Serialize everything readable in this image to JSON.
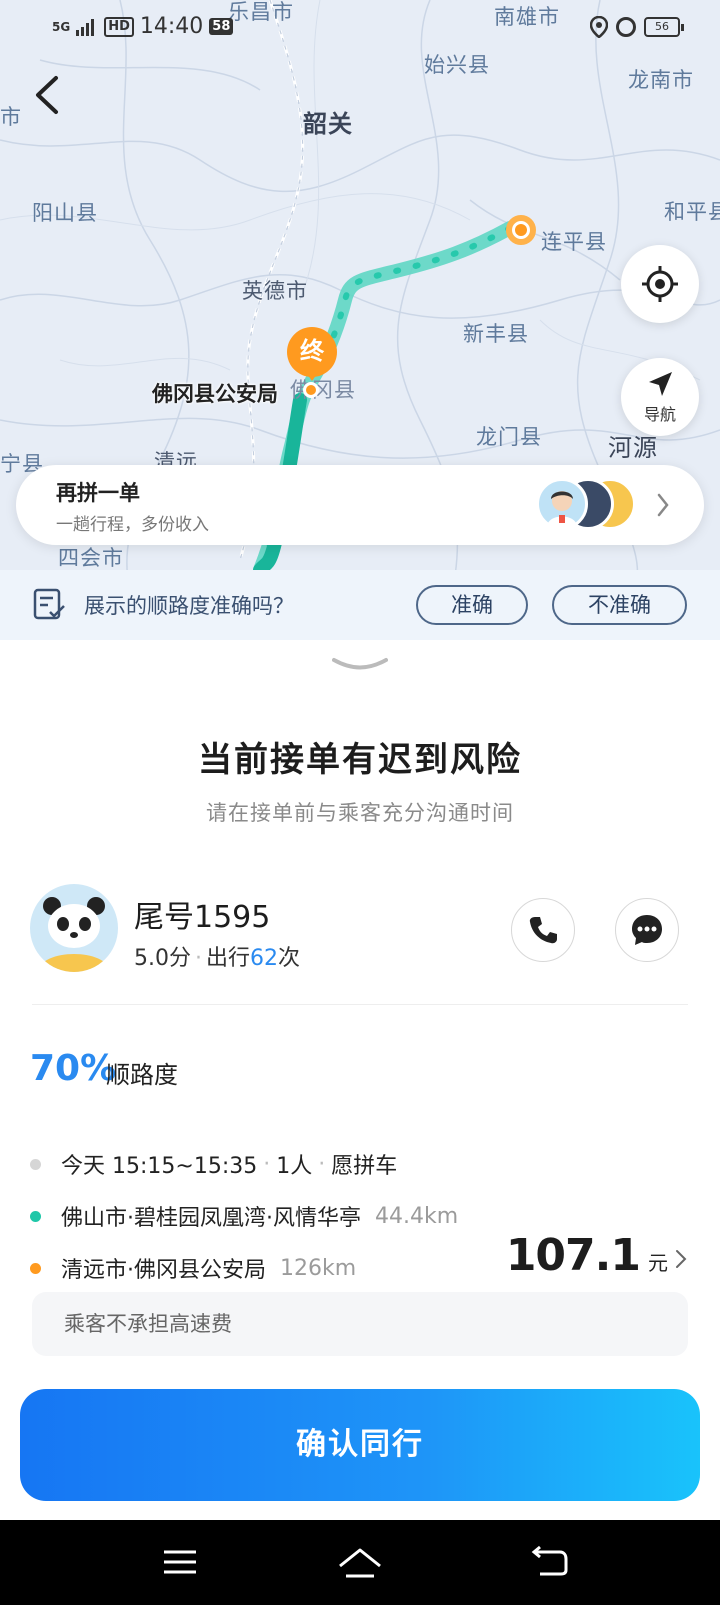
{
  "status_bar": {
    "network": "5G",
    "hd": "HD",
    "time": "14:40",
    "badge": "58",
    "battery": "56"
  },
  "map": {
    "places": {
      "lechang": "乐昌市",
      "nanxiong": "南雄市",
      "shixing": "始兴县",
      "longnan": "龙南市",
      "shaoguan": "韶关",
      "city_left": "市",
      "yangshan": "阳山县",
      "lianping": "连平县",
      "heping": "和平县",
      "yingde": "英德市",
      "xinfeng": "新丰县",
      "fogang": "佛冈县",
      "longmen": "龙门县",
      "heyuan": "河源",
      "ning": "宁县",
      "qingyuan": "清远",
      "sihui": "四会市"
    },
    "end_marker": "终",
    "end_label": "佛冈县公安局",
    "nav_label": "导航",
    "route_color": "#5fd6c4"
  },
  "carpool_banner": {
    "title": "再拼一单",
    "subtitle": "一趟行程，多份收入"
  },
  "feedback": {
    "question": "展示的顺路度准确吗？",
    "accurate": "准确",
    "inaccurate": "不准确"
  },
  "sheet": {
    "title": "当前接单有迟到风险",
    "subtitle": "请在接单前与乘客充分沟通时间"
  },
  "passenger": {
    "name": "尾号1595",
    "rating": "5.0分",
    "trips_prefix": "出行",
    "trips_count": "62",
    "trips_suffix": "次"
  },
  "match": {
    "percent": "70%",
    "label": "顺路度"
  },
  "trip": {
    "time": "今天 15:15~15:35",
    "seats": "1人",
    "pool": "愿拼车",
    "origin": "佛山市·碧桂园凤凰湾·风情华亭",
    "origin_distance": "44.4km",
    "destination": "清远市·佛冈县公安局",
    "destination_distance": "126km",
    "fare": "107.1",
    "fare_unit": "元",
    "highway_note": "乘客不承担高速费"
  },
  "actions": {
    "confirm": "确认同行"
  },
  "colors": {
    "accent": "#2a8af0",
    "orange": "#ff9a1f",
    "green": "#1fc7a8"
  }
}
